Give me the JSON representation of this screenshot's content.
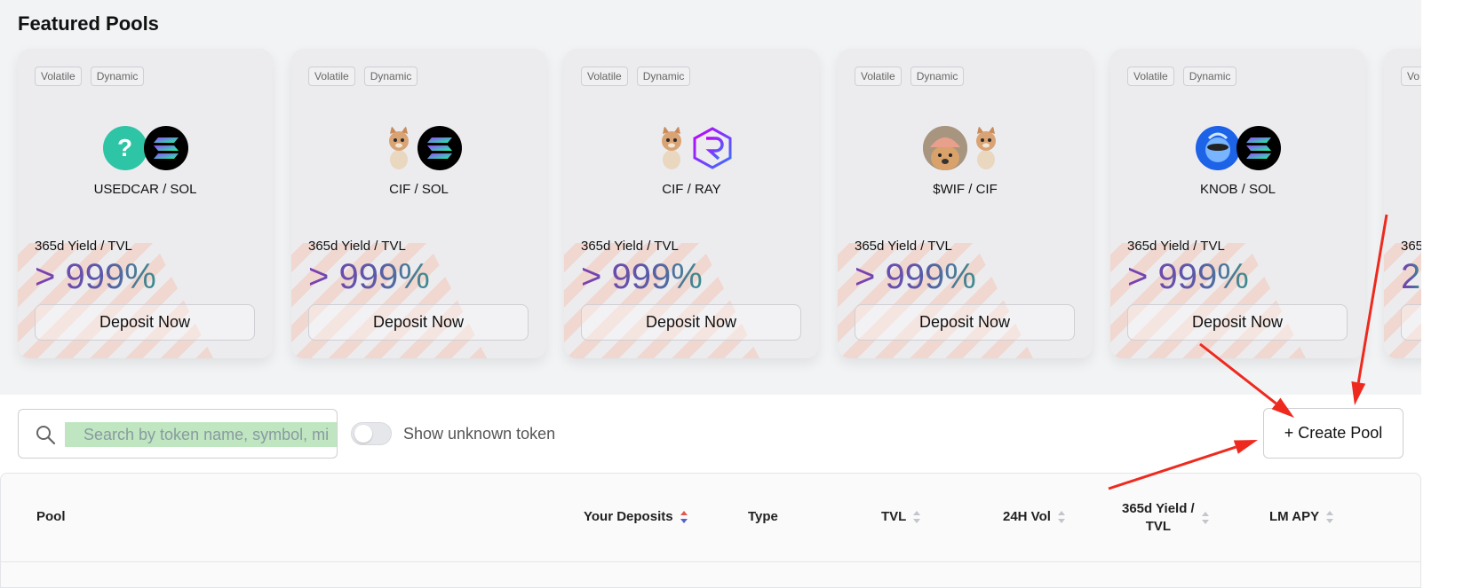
{
  "featured": {
    "title": "Featured Pools",
    "cards": [
      {
        "tags": [
          "Volatile",
          "Dynamic"
        ],
        "pair": "USEDCAR / SOL",
        "yield_label": "365d Yield / TVL",
        "yield_value": "> 999%",
        "deposit_label": "Deposit Now",
        "logo_left": "question-mark-token-icon",
        "logo_right": "sol-token-icon"
      },
      {
        "tags": [
          "Volatile",
          "Dynamic"
        ],
        "pair": "CIF / SOL",
        "yield_label": "365d Yield / TVL",
        "yield_value": "> 999%",
        "deposit_label": "Deposit Now",
        "logo_left": "cif-cat-token-icon",
        "logo_right": "sol-token-icon"
      },
      {
        "tags": [
          "Volatile",
          "Dynamic"
        ],
        "pair": "CIF / RAY",
        "yield_label": "365d Yield / TVL",
        "yield_value": "> 999%",
        "deposit_label": "Deposit Now",
        "logo_left": "cif-cat-token-icon",
        "logo_right": "ray-token-icon"
      },
      {
        "tags": [
          "Volatile",
          "Dynamic"
        ],
        "pair": "$WIF / CIF",
        "yield_label": "365d Yield / TVL",
        "yield_value": "> 999%",
        "deposit_label": "Deposit Now",
        "logo_left": "wif-dog-token-icon",
        "logo_right": "cif-cat-token-icon"
      },
      {
        "tags": [
          "Volatile",
          "Dynamic"
        ],
        "pair": "KNOB / SOL",
        "yield_label": "365d Yield / TVL",
        "yield_value": "> 999%",
        "deposit_label": "Deposit Now",
        "logo_left": "knob-token-icon",
        "logo_right": "sol-token-icon"
      }
    ],
    "partial_card": {
      "tag": "Vo",
      "yield_label": "365",
      "yield_value": "2"
    }
  },
  "filters": {
    "search_placeholder": "Search by token name, symbol, mi",
    "toggle_label": "Show unknown token",
    "toggle_on": false,
    "create_label": "+ Create Pool"
  },
  "table": {
    "columns": [
      {
        "label": "Pool",
        "sortable": false
      },
      {
        "label": "Your Deposits",
        "sortable": true,
        "active": true
      },
      {
        "label": "Type",
        "sortable": false
      },
      {
        "label": "TVL",
        "sortable": true
      },
      {
        "label": "24H Vol",
        "sortable": true
      },
      {
        "label": "365d Yield / TVL",
        "line1": "365d Yield /",
        "line2": "TVL",
        "sortable": true
      },
      {
        "label": "LM APY",
        "sortable": true
      }
    ]
  },
  "colors": {
    "accent_gradient": [
      "#7b3fb0",
      "#3f8c8c"
    ],
    "annotation_arrow": "#ee2a1f",
    "search_highlight": "#bfe6c0"
  }
}
